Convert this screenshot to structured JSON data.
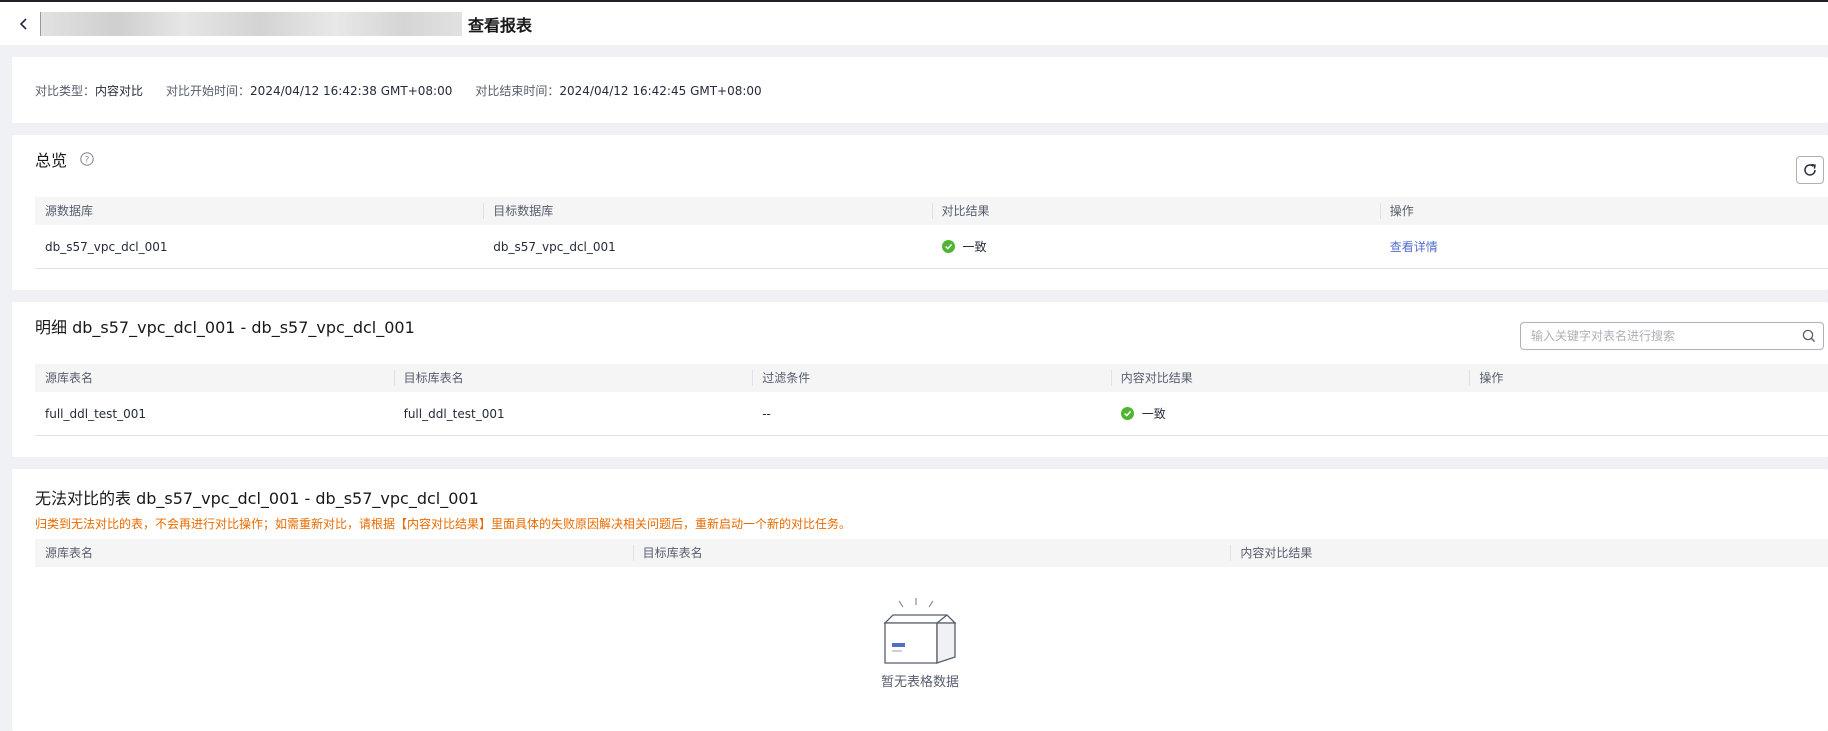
{
  "header": {
    "title": "查看报表"
  },
  "meta": {
    "type_label": "对比类型：",
    "type_value": "内容对比",
    "start_label": "对比开始时间：",
    "start_value": "2024/04/12 16:42:38 GMT+08:00",
    "end_label": "对比结束时间：",
    "end_value": "2024/04/12 16:42:45 GMT+08:00"
  },
  "overview": {
    "title": "总览",
    "columns": [
      "源数据库",
      "目标数据库",
      "对比结果",
      "操作"
    ],
    "rows": [
      {
        "source": "db_s57_vpc_dcl_001",
        "target": "db_s57_vpc_dcl_001",
        "result": "一致",
        "action": "查看详情"
      }
    ]
  },
  "detail": {
    "title": "明细 db_s57_vpc_dcl_001 - db_s57_vpc_dcl_001",
    "search_placeholder": "输入关键字对表名进行搜索",
    "columns": [
      "源库表名",
      "目标库表名",
      "过滤条件",
      "内容对比结果",
      "操作"
    ],
    "rows": [
      {
        "source": "full_ddl_test_001",
        "target": "full_ddl_test_001",
        "filter": "--",
        "result": "一致",
        "action": ""
      }
    ]
  },
  "unable": {
    "title": "无法对比的表 db_s57_vpc_dcl_001 - db_s57_vpc_dcl_001",
    "notice": "归类到无法对比的表，不会再进行对比操作；如需重新对比，请根据【内容对比结果】里面具体的失败原因解决相关问题后，重新启动一个新的对比任务。",
    "columns": [
      "源库表名",
      "目标库表名",
      "内容对比结果"
    ],
    "empty_text": "暂无表格数据"
  },
  "colors": {
    "success": "#50b432",
    "link": "#526ecc",
    "warning": "#e86b00"
  },
  "icons": {
    "back": "chevron-left-icon",
    "help": "question-circle-icon",
    "refresh": "refresh-icon",
    "search": "search-icon",
    "success": "check-circle-icon",
    "empty": "empty-box-icon"
  }
}
